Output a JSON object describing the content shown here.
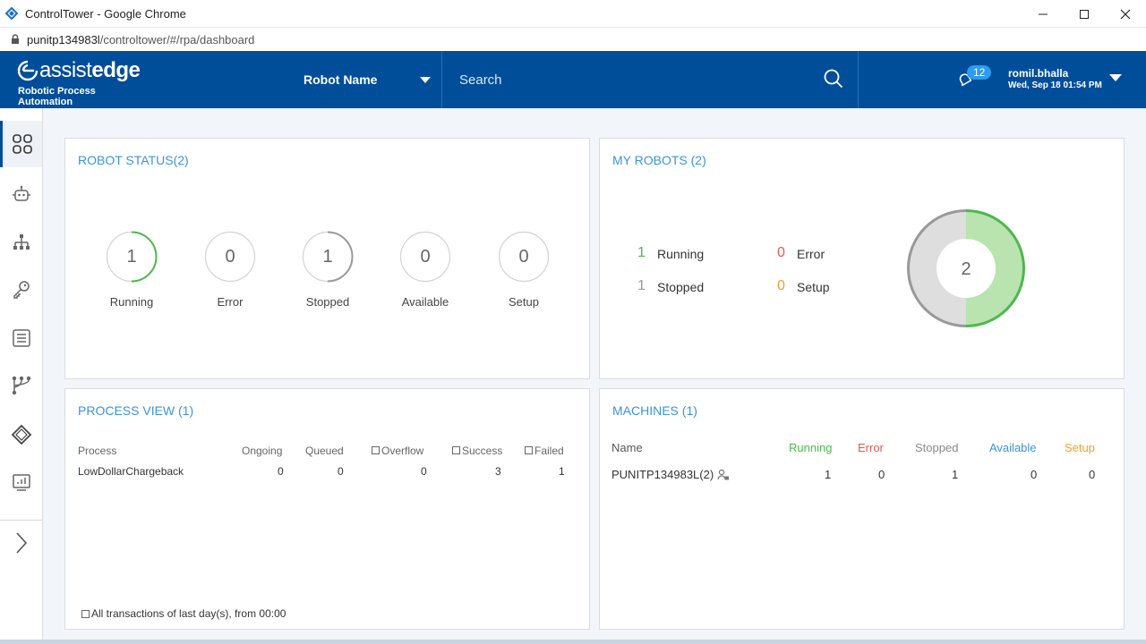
{
  "window": {
    "title": "ControlTower - Google Chrome"
  },
  "address": {
    "host": "punitp134983l",
    "path": "/controltower/#/rpa/dashboard"
  },
  "header": {
    "logo_text_light": "assist",
    "logo_text_bold": "edge",
    "logo_sub": "Robotic Process Automation",
    "robot_select_label": "Robot Name",
    "search_placeholder": "Search",
    "notification_count": "12",
    "user_name": "romil.bhalla",
    "user_datetime": "Wed, Sep 18 01:54 PM"
  },
  "sidebar": {
    "items": [
      {
        "icon": "dashboard-grid-icon"
      },
      {
        "icon": "robot-icon"
      },
      {
        "icon": "hierarchy-icon"
      },
      {
        "icon": "key-icon"
      },
      {
        "icon": "document-list-icon"
      },
      {
        "icon": "workflow-branch-icon"
      },
      {
        "icon": "diamond-chip-icon"
      },
      {
        "icon": "report-chart-icon"
      }
    ],
    "expand_icon": "chevron-right-icon"
  },
  "robot_status": {
    "title": "ROBOT STATUS(2)",
    "items": [
      {
        "label": "Running",
        "value": "1",
        "ring_color": "#4cb84c",
        "fill": 0.5
      },
      {
        "label": "Error",
        "value": "0",
        "ring_color": "#cccccc",
        "fill": 0
      },
      {
        "label": "Stopped",
        "value": "1",
        "ring_color": "#999999",
        "fill": 0.5
      },
      {
        "label": "Available",
        "value": "0",
        "ring_color": "#cccccc",
        "fill": 0
      },
      {
        "label": "Setup",
        "value": "0",
        "ring_color": "#cccccc",
        "fill": 0
      }
    ]
  },
  "my_robots": {
    "title": "MY ROBOTS (2)",
    "running_count": "1",
    "running_label": "Running",
    "stopped_count": "1",
    "stopped_label": "Stopped",
    "error_count": "0",
    "error_label": "Error",
    "setup_count": "0",
    "setup_label": "Setup",
    "donut_total": "2",
    "donut_running_fraction": 0.5,
    "colors": {
      "running": "#4cb84c",
      "stopped": "#999999",
      "error": "#e05a4a",
      "setup": "#f0a030",
      "running_fill": "#b9e4b0",
      "stopped_fill": "#dedede"
    }
  },
  "process_view": {
    "title": "PROCESS VIEW (1)",
    "headers": {
      "process": "Process",
      "ongoing": "Ongoing",
      "queued": "Queued",
      "overflow": "Overflow",
      "success": "Success",
      "failed": "Failed"
    },
    "row": {
      "process": "LowDollarChargeback",
      "ongoing": "0",
      "queued": "0",
      "overflow": "0",
      "success": "3",
      "failed": "1"
    },
    "footer": "All transactions of last day(s), from 00:00"
  },
  "machines": {
    "title": "MACHINES (1)",
    "headers": {
      "name": "Name",
      "running": "Running",
      "error": "Error",
      "stopped": "Stopped",
      "available": "Available",
      "setup": "Setup"
    },
    "header_colors": {
      "running": "#4cb84c",
      "error": "#e05a4a",
      "stopped": "#888888",
      "available": "#3b94d9",
      "setup": "#f0a030"
    },
    "row": {
      "name": "PUNITP134983L(2)",
      "running": "1",
      "error": "0",
      "stopped": "1",
      "available": "0",
      "setup": "0"
    }
  }
}
